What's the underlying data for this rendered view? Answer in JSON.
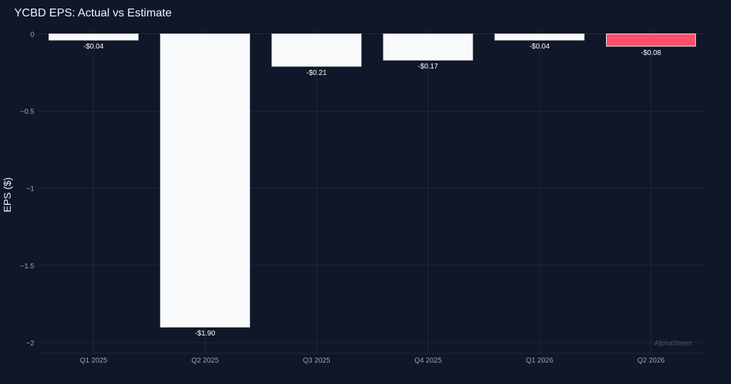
{
  "chart_data": {
    "type": "bar",
    "title": "YCBD EPS: Actual vs Estimate",
    "xlabel": "",
    "ylabel": "EPS ($)",
    "categories": [
      "Q1 2025",
      "Q2 2025",
      "Q3 2025",
      "Q4 2025",
      "Q1 2026",
      "Q2 2026"
    ],
    "values": [
      -0.04,
      -1.9,
      -0.21,
      -0.17,
      -0.04,
      -0.08
    ],
    "data_labels": [
      "-$0.04",
      "-$1.90",
      "-$0.21",
      "-$0.17",
      "-$0.04",
      "-$0.08"
    ],
    "bar_colors": [
      "#f8fafc",
      "#f8fafc",
      "#f8fafc",
      "#f8fafc",
      "#f8fafc",
      "#ff4d6a"
    ],
    "ylim": [
      -2.07,
      0.03
    ],
    "yticks": [
      0,
      -0.5,
      -1,
      -1.5,
      -2
    ],
    "ytick_labels": [
      "0",
      "−0.5",
      "−1",
      "−1.5",
      "−2"
    ],
    "grid": true,
    "watermark": "AlphaStreet"
  },
  "colors": {
    "background": "#0f1729",
    "grid": "#1f2a3d",
    "text": "#f2f4f8",
    "tick_text": "#9aa3b2"
  }
}
